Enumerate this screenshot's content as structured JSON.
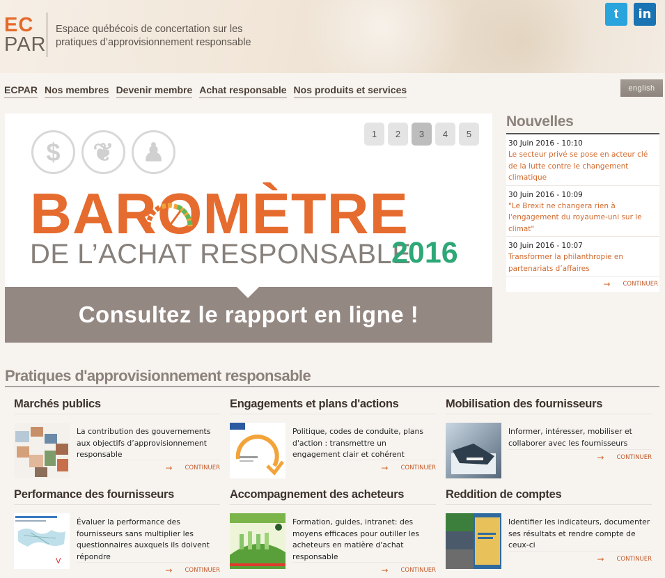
{
  "header": {
    "logo_top": "EC",
    "logo_bottom": "PAR",
    "tagline": "Espace québécois de concertation sur les pratiques d’approvisionnement responsable",
    "twitter_glyph": "t",
    "linkedin_glyph": "in"
  },
  "nav": {
    "items": [
      "ECPAR",
      "Nos membres",
      "Devenir membre",
      "Achat responsable",
      "Nos produits et services"
    ],
    "lang": "english"
  },
  "banner": {
    "pages": [
      "1",
      "2",
      "3",
      "4",
      "5"
    ],
    "active_page": "3",
    "icons": [
      "dollar-icon",
      "leaf-icon",
      "person-icon"
    ],
    "icon_glyphs": [
      "$",
      "❦",
      "♟"
    ],
    "title": "BAROMÈTRE",
    "subtitle": "DE L’ACHAT RESPONSABLE",
    "year": "2016",
    "cta": "Consultez le rapport en ligne !"
  },
  "news": {
    "title": "Nouvelles",
    "items": [
      {
        "date": "30 Juin 2016 - 10:10",
        "text": "Le secteur privé se pose en acteur clé de la lutte contre le changement climatique"
      },
      {
        "date": "30 Juin 2016 - 10:09",
        "text": "\"Le Brexit ne changera rien à l'engagement du royaume-uni sur le climat\""
      },
      {
        "date": "30 Juin 2016 - 10:07",
        "text": "Transformer la philanthropie en partenariats d’affaires"
      }
    ],
    "more": "CONTINUER"
  },
  "practices": {
    "title": "Pratiques d'approvisionnement responsable",
    "more": "CONTINUER",
    "cards": [
      {
        "title": "Marchés publics",
        "desc": "La contribution des gouvernements aux objectifs d’approvisionnement responsable"
      },
      {
        "title": "Engagements et plans d'actions",
        "desc": "Politique, codes de conduite, plans d'action : transmettre un engagement clair et cohérent"
      },
      {
        "title": "Mobilisation des fournisseurs",
        "desc": "Informer, intéresser, mobiliser et collaborer avec les fournisseurs"
      },
      {
        "title": "Performance des fournisseurs",
        "desc": "Évaluer la performance des fournisseurs sans multiplier les questionnaires auxquels ils doivent répondre"
      },
      {
        "title": "Accompagnement des acheteurs",
        "desc": "Formation, guides, intranet: des moyens efficaces pour outiller les acheteurs en matière d'achat responsable"
      },
      {
        "title": "Reddition de comptes",
        "desc": "Identifier les indicateurs, documenter ses résultats et rendre compte de ceux-ci"
      }
    ]
  },
  "colors": {
    "brand_orange": "#e56b2e",
    "brand_green": "#2da876",
    "banner_grey": "#948882",
    "link_orange": "#d26a2f"
  }
}
